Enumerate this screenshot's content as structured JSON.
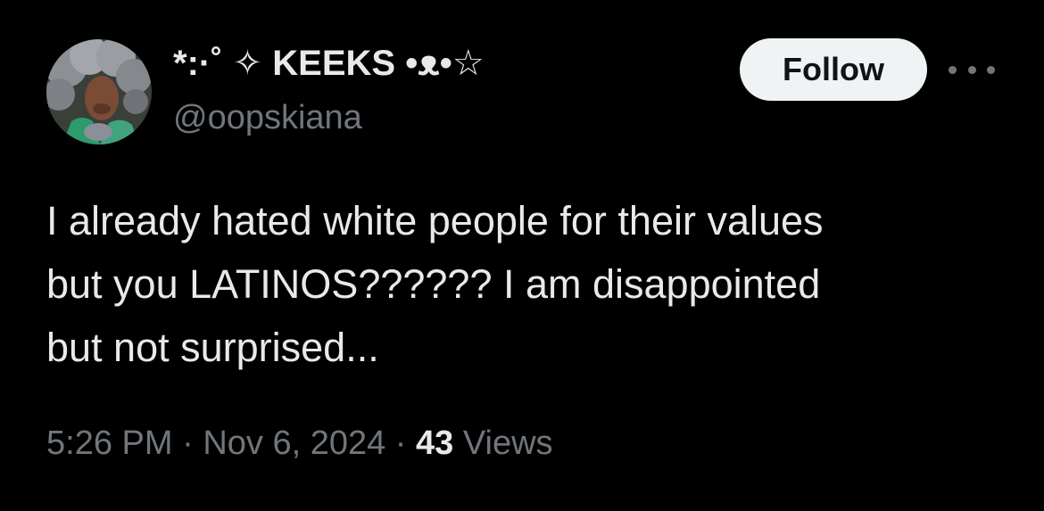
{
  "user": {
    "display_name": "*:·˚ ✧ KEEKS •ᴥ•☆",
    "handle": "@oopskiana",
    "avatar": "profile-photo"
  },
  "actions": {
    "follow_label": "Follow",
    "more_icon": "more-horizontal-icon"
  },
  "tweet": {
    "lines": [
      "I already hated white people for their values",
      "but you LATINOS?????? I am disappointed",
      "but not surprised..."
    ]
  },
  "meta": {
    "time": "5:26 PM",
    "separator": " · ",
    "date": "Nov 6, 2024",
    "views_count": "43",
    "views_label": " Views"
  },
  "colors": {
    "background": "#000000",
    "primary_text": "#e7e9ea",
    "secondary_text": "#71767b",
    "follow_bg": "#eff3f4",
    "follow_text": "#0f1419"
  }
}
